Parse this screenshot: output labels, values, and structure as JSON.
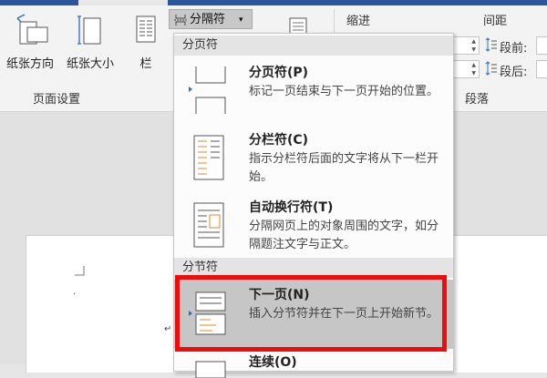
{
  "ribbon": {
    "orientation_label": "纸张方向",
    "size_label": "纸张大小",
    "columns_label": "栏",
    "group_page_setup": "页面设置",
    "breaks_button_label": "分隔符",
    "indent_label": "缩进",
    "spacing_label": "间距",
    "before_label": "段前:",
    "after_label": "段后:",
    "group_paragraph": "段落"
  },
  "menu": {
    "section_page_breaks": "分页符",
    "section_section_breaks": "分节符",
    "items": [
      {
        "title": "分页符(P)",
        "desc": "标记一页结束与下一页开始的位置。"
      },
      {
        "title": "分栏符(C)",
        "desc": "指示分栏符后面的文字将从下一栏开始。"
      },
      {
        "title": "自动换行符(T)",
        "desc": "分隔网页上的对象周围的文字，如分隔题注文字与正文。"
      },
      {
        "title": "下一页(N)",
        "desc": "插入分节符并在下一页上开始新节。"
      },
      {
        "title": "连续(O)",
        "desc": ""
      }
    ]
  },
  "colors": {
    "title_bar": "#2b579a",
    "highlight_box": "#ee0d0d",
    "menu_highlight": "#c6c6c6"
  }
}
